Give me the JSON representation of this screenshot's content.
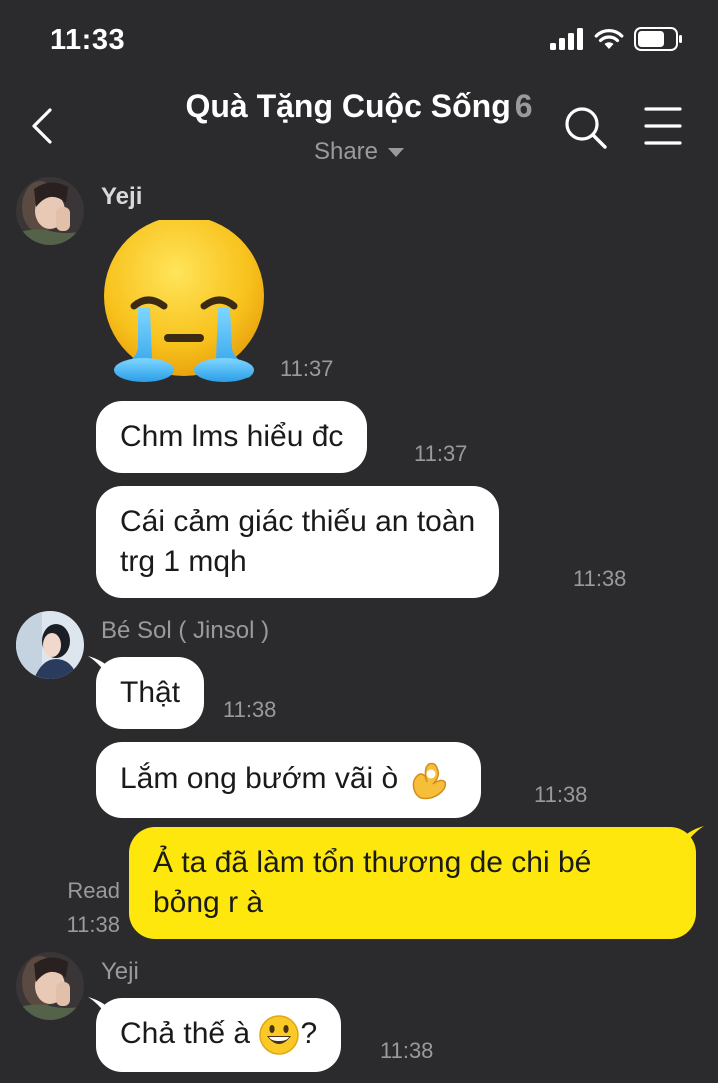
{
  "status_bar": {
    "time": "11:33"
  },
  "header": {
    "title": "Quà Tặng Cuộc Sống",
    "member_count": "6",
    "share_label": "Share"
  },
  "messages": [
    {
      "sender": "Yeji",
      "type": "sticker",
      "sticker": "crying-face-sticker",
      "time": "11:37"
    },
    {
      "sender": "Yeji",
      "type": "text",
      "text": "Chm lms hiểu đc",
      "time": "11:37"
    },
    {
      "sender": "Yeji",
      "type": "text",
      "lines": [
        "Cái cảm giác thiếu an toàn",
        "trg 1 mqh"
      ],
      "time": "11:38"
    },
    {
      "sender": "Bé Sol ( Jinsol )",
      "type": "text",
      "text": "Thật",
      "time": "11:38"
    },
    {
      "sender": "Bé Sol ( Jinsol )",
      "type": "text",
      "text": "Lắm ong bướm vãi ò",
      "emoji": "ok-hand-emoji",
      "time": "11:38"
    },
    {
      "sender": "me",
      "type": "text",
      "lines": [
        "Ả ta đã làm tổn thương de chi bé",
        "bỏng r à"
      ],
      "time": "11:38",
      "read_label": "Read"
    },
    {
      "sender": "Yeji",
      "type": "text",
      "text": "Chả thế à",
      "emoji": "grinning-face-emoji",
      "suffix": "?",
      "time": "11:38"
    }
  ],
  "colors": {
    "background": "#2b2b2d",
    "bubble_other": "#ffffff",
    "bubble_mine": "#fde70c",
    "muted_text": "#9a9a9c"
  }
}
